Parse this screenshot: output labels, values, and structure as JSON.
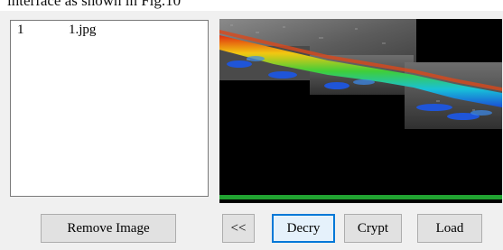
{
  "caption": "interface as shown in Fig.10",
  "file_list": {
    "items": [
      {
        "index": "1",
        "name": "1.jpg"
      }
    ]
  },
  "progress": {
    "value_percent": 100,
    "color": "#21a331"
  },
  "buttons": {
    "remove_image": "Remove Image",
    "previous": "<<",
    "decry": "Decry",
    "crypt": "Crypt",
    "load": "Load"
  },
  "preview": {
    "description_icon": "ultrasound-image"
  }
}
